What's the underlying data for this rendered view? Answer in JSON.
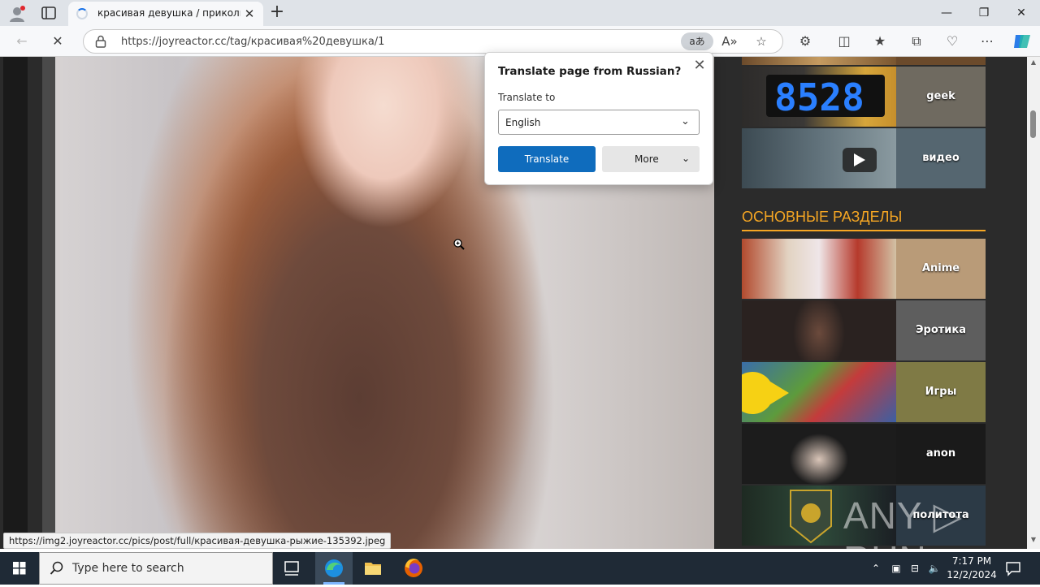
{
  "browser": {
    "tab": {
      "title": "красивая девушка / прикольны"
    },
    "new_tab": "+",
    "window": {
      "minimize": "—",
      "restore": "❐",
      "close": "✕"
    },
    "address": {
      "url": "https://joyreactor.cc/tag/красивая%20девушка/1",
      "translate_badge": "aあ"
    }
  },
  "sidebar": {
    "top_tiles": [
      {
        "label": "geek"
      },
      {
        "label": "видео"
      }
    ],
    "section_title": "ОСНОВНЫЕ РАЗДЕЛЫ",
    "tiles": [
      {
        "label": "Anime"
      },
      {
        "label": "Эротика"
      },
      {
        "label": "Игры"
      },
      {
        "label": "anon"
      },
      {
        "label": "политота"
      }
    ]
  },
  "translate_popup": {
    "heading": "Translate page from Russian?",
    "to_label": "Translate to",
    "language": "English",
    "translate_button": "Translate",
    "more_button": "More"
  },
  "status_url": "https://img2.joyreactor.cc/pics/post/full/красивая-девушка-рыжие-135392.jpeg",
  "watermark": "ANY ▷ RUN",
  "taskbar": {
    "search_placeholder": "Type here to search",
    "time": "7:17 PM",
    "date": "12/2/2024"
  },
  "colors": {
    "section_accent": "#f5a623",
    "translate_button": "#0f6cbd",
    "taskbar": "#1f2a36"
  }
}
